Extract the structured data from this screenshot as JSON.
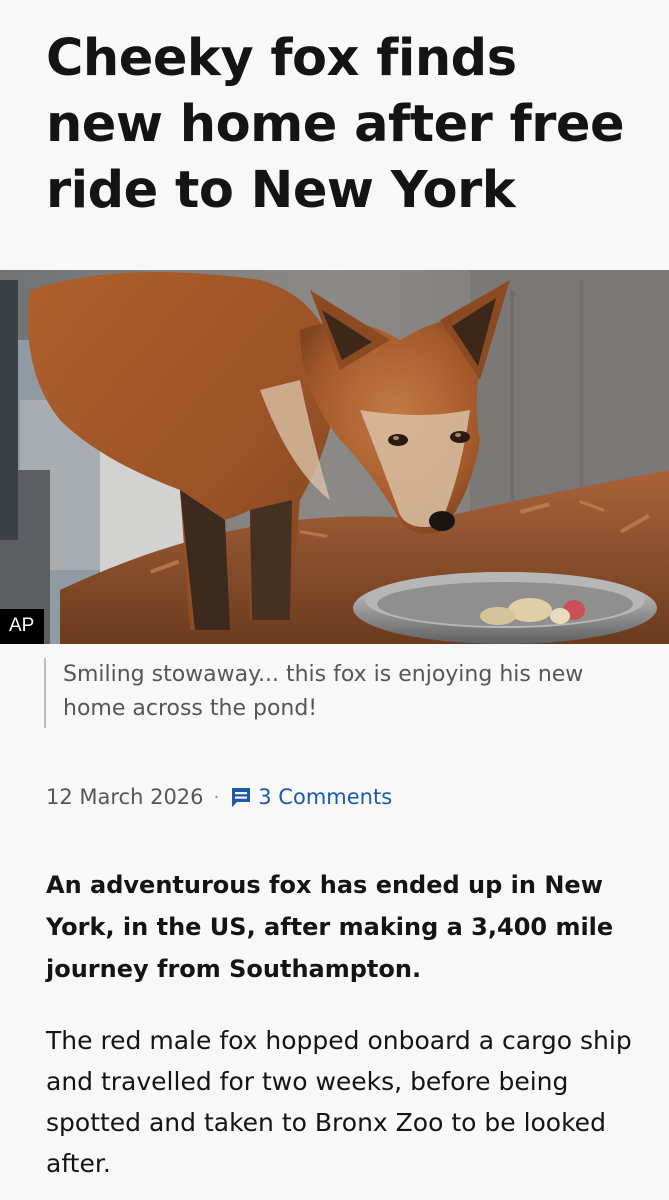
{
  "article": {
    "headline": "Cheeky fox finds new home after free ride to New York",
    "image": {
      "credit": "AP"
    },
    "caption": "Smiling stowaway... this fox is enjoying his new home across the pond!",
    "date": "12 March 2026",
    "separator": "·",
    "comments_label": "3 Comments",
    "lead": "An adventurous fox has ended up in New York, in the US, after making a 3,400 mile journey from Southampton.",
    "body": "The red male fox hopped onboard a cargo ship and travelled for two weeks, before being spotted and taken to Bronx Zoo to be looked after."
  },
  "colors": {
    "background": "#f8f8f8",
    "text": "#141414",
    "muted_text": "#545658",
    "link": "#1a5aa8",
    "credit_bg": "#000000"
  },
  "icons": {
    "comments": "comment-bubble-icon"
  }
}
